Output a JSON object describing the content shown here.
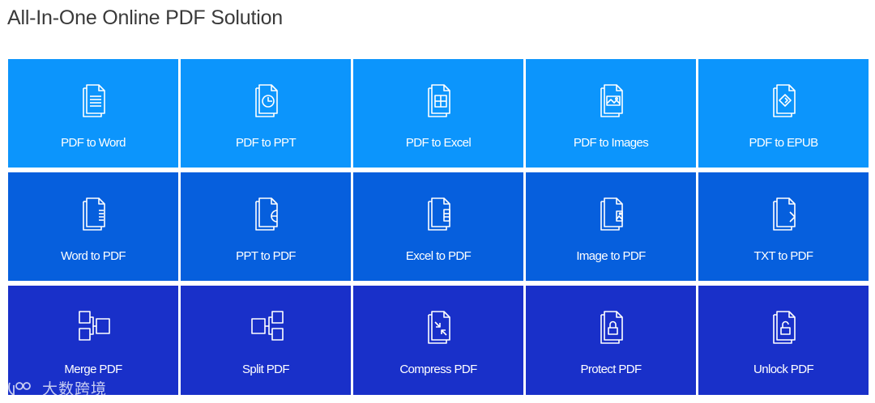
{
  "page": {
    "title": "All-In-One Online PDF Solution"
  },
  "colors": {
    "row1_bg": "#0c95fc",
    "row2_bg": "#065fdd",
    "row3_bg": "#1930c9",
    "text": "#ffffff",
    "title": "#3a3a3a"
  },
  "tiles": [
    {
      "label": "PDF to Word",
      "icon": "pdf-to-word-icon"
    },
    {
      "label": "PDF to PPT",
      "icon": "pdf-to-ppt-icon"
    },
    {
      "label": "PDF to Excel",
      "icon": "pdf-to-excel-icon"
    },
    {
      "label": "PDF to Images",
      "icon": "pdf-to-images-icon"
    },
    {
      "label": "PDF to EPUB",
      "icon": "pdf-to-epub-icon"
    },
    {
      "label": "Word to PDF",
      "icon": "word-to-pdf-icon"
    },
    {
      "label": "PPT to PDF",
      "icon": "ppt-to-pdf-icon"
    },
    {
      "label": "Excel to PDF",
      "icon": "excel-to-pdf-icon"
    },
    {
      "label": "Image to PDF",
      "icon": "image-to-pdf-icon"
    },
    {
      "label": "TXT to PDF",
      "icon": "txt-to-pdf-icon"
    },
    {
      "label": "Merge PDF",
      "icon": "merge-pdf-icon"
    },
    {
      "label": "Split PDF",
      "icon": "split-pdf-icon"
    },
    {
      "label": "Compress PDF",
      "icon": "compress-pdf-icon"
    },
    {
      "label": "Protect PDF",
      "icon": "protect-pdf-icon"
    },
    {
      "label": "Unlock PDF",
      "icon": "unlock-pdf-icon"
    }
  ],
  "watermark": {
    "text": "大数跨境",
    "icon": "watermark-logo-icon"
  }
}
